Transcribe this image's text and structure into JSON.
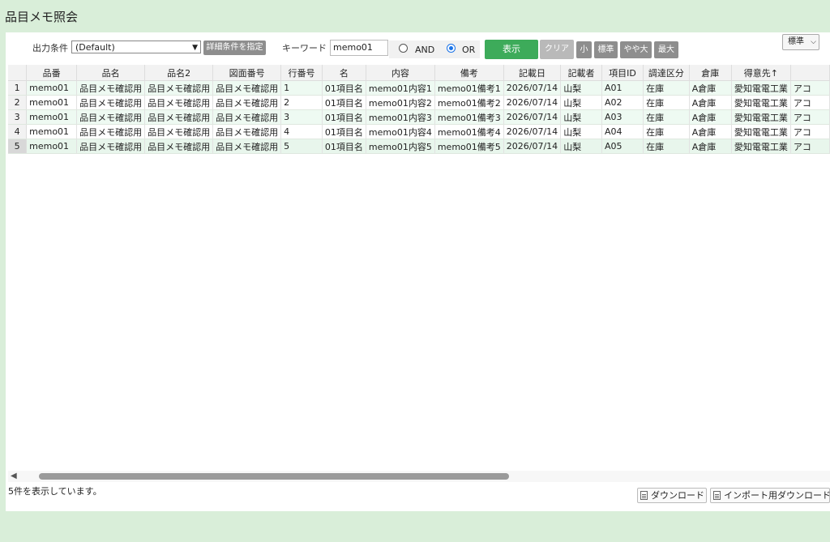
{
  "page": {
    "title": "品目メモ照会"
  },
  "toolbar": {
    "output_label": "出力条件",
    "output_value": "(Default)",
    "detail_button": "詳細条件を指定",
    "keyword_label": "キーワード",
    "keyword_value": "memo01",
    "and_label": "AND",
    "or_label": "OR",
    "selected_mode": "OR",
    "show_button": "表示",
    "clear_button": "クリア",
    "size_small": "小",
    "size_standard": "標準",
    "size_large": "やや大",
    "size_max": "最大",
    "display_size": "標準"
  },
  "table": {
    "columns": [
      "品番",
      "品名",
      "品名2",
      "図面番号",
      "行番号",
      "名",
      "内容",
      "備考",
      "記載日",
      "記載者",
      "項目ID",
      "調達区分",
      "倉庫",
      "得意先↑",
      ""
    ],
    "rows": [
      {
        "no": "1",
        "cells": [
          "memo01",
          "品目メモ確認用",
          "品目メモ確認用",
          "品目メモ確認用",
          "1",
          "01項目名",
          "memo01内容1",
          "memo01備考1",
          "2026/07/14",
          "山梨",
          "A01",
          "在庫",
          "A倉庫",
          "愛知電電工業",
          "アコ"
        ]
      },
      {
        "no": "2",
        "cells": [
          "memo01",
          "品目メモ確認用",
          "品目メモ確認用",
          "品目メモ確認用",
          "2",
          "01項目名",
          "memo01内容2",
          "memo01備考2",
          "2026/07/14",
          "山梨",
          "A02",
          "在庫",
          "A倉庫",
          "愛知電電工業",
          "アコ"
        ]
      },
      {
        "no": "3",
        "cells": [
          "memo01",
          "品目メモ確認用",
          "品目メモ確認用",
          "品目メモ確認用",
          "3",
          "01項目名",
          "memo01内容3",
          "memo01備考3",
          "2026/07/14",
          "山梨",
          "A03",
          "在庫",
          "A倉庫",
          "愛知電電工業",
          "アコ"
        ]
      },
      {
        "no": "4",
        "cells": [
          "memo01",
          "品目メモ確認用",
          "品目メモ確認用",
          "品目メモ確認用",
          "4",
          "01項目名",
          "memo01内容4",
          "memo01備考4",
          "2026/07/14",
          "山梨",
          "A04",
          "在庫",
          "A倉庫",
          "愛知電電工業",
          "アコ"
        ]
      },
      {
        "no": "5",
        "cells": [
          "memo01",
          "品目メモ確認用",
          "品目メモ確認用",
          "品目メモ確認用",
          "5",
          "01項目名",
          "memo01内容5",
          "memo01備考5",
          "2026/07/14",
          "山梨",
          "A05",
          "在庫",
          "A倉庫",
          "愛知電電工業",
          "アコ"
        ]
      }
    ]
  },
  "footer": {
    "status_text": "5件を表示しています。",
    "download_button": "ダウンロード",
    "import_download_button": "インポート用ダウンロード"
  },
  "colors": {
    "accent_green": "#3dab5a",
    "page_bg": "#d9eed9",
    "radio_blue": "#1a73e8"
  }
}
